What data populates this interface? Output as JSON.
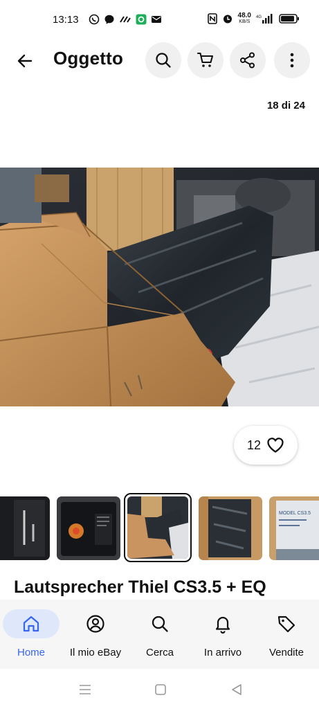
{
  "status_bar": {
    "time": "13:13",
    "network_speed": "48.0",
    "network_unit": "KB/S",
    "signal": "4G",
    "left_icons": [
      "whatsapp-icon",
      "messenger-icon",
      "app-icon",
      "green-app-icon",
      "email-icon"
    ],
    "right_icons": [
      "nfc-icon",
      "alarm-icon",
      "signal-icon",
      "battery-icon"
    ]
  },
  "app_bar": {
    "title": "Oggetto",
    "icons": [
      "back-arrow-icon",
      "search-icon",
      "cart-icon",
      "share-icon",
      "more-vert-icon"
    ]
  },
  "gallery": {
    "counter": "18 di 24",
    "likes": "12",
    "selected_thumbnail_index": 2,
    "thumbnails": [
      "speaker-label",
      "speaker-back-panel",
      "boxes-wrapped-speaker",
      "wrapped-speaker-in-box",
      "box-label-model-cs3.5"
    ],
    "thumbnail_label_text": "MODEL CS3.5"
  },
  "item": {
    "title": "Lautsprecher Thiel CS3.5 + EQ"
  },
  "bottom_nav": {
    "active": "home",
    "items": [
      {
        "id": "home",
        "label": "Home",
        "icon": "home-icon"
      },
      {
        "id": "my-ebay",
        "label": "Il mio eBay",
        "icon": "user-circle-icon"
      },
      {
        "id": "search",
        "label": "Cerca",
        "icon": "search-icon"
      },
      {
        "id": "inbox",
        "label": "In arrivo",
        "icon": "bell-icon"
      },
      {
        "id": "selling",
        "label": "Vendite",
        "icon": "tag-icon"
      }
    ]
  },
  "colors": {
    "accent": "#3665f3",
    "active_pill": "#dfe8fb",
    "nav_background": "#f6f6f6",
    "button_background": "#f0f0f0"
  }
}
